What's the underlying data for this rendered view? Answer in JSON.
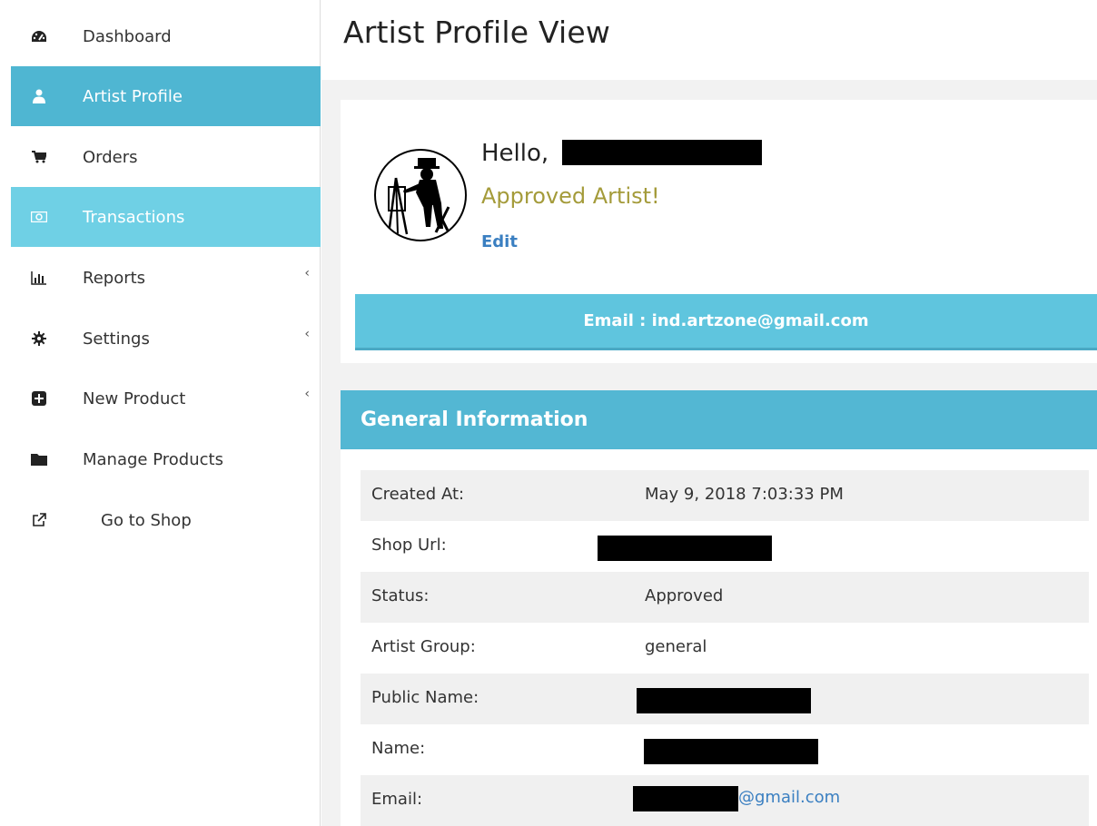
{
  "sidebar": {
    "items": [
      {
        "label": "Dashboard",
        "icon": "dashboard-icon"
      },
      {
        "label": "Artist Profile",
        "icon": "user-icon"
      },
      {
        "label": "Orders",
        "icon": "cart-icon"
      },
      {
        "label": "Transactions",
        "icon": "money-icon"
      },
      {
        "label": "Reports",
        "icon": "bar-chart-icon",
        "chevron": "‹"
      },
      {
        "label": "Settings",
        "icon": "gear-icon",
        "chevron": "‹"
      },
      {
        "label": "New Product",
        "icon": "plus-square-icon",
        "chevron": "‹"
      },
      {
        "label": "Manage Products",
        "icon": "folder-icon"
      },
      {
        "label": "Go to Shop",
        "icon": "external-link-icon"
      }
    ]
  },
  "header": {
    "title": "Artist Profile View"
  },
  "profile": {
    "greeting": "Hello,",
    "status_text": "Approved Artist!",
    "edit_label": "Edit",
    "email_bar": "Email : ind.artzone@gmail.com"
  },
  "general": {
    "title": "General Information",
    "rows": [
      {
        "label": "Created At:",
        "value": "May 9, 2018 7:03:33 PM"
      },
      {
        "label": "Shop Url:",
        "value": ""
      },
      {
        "label": "Status:",
        "value": "Approved"
      },
      {
        "label": "Artist Group:",
        "value": "general"
      },
      {
        "label": "Public Name:",
        "value": ""
      },
      {
        "label": "Name:",
        "value": ""
      },
      {
        "label": "Email:",
        "value": "@gmail.com"
      }
    ]
  },
  "colors": {
    "accent": "#4fb6d2",
    "accent_light": "#6fd0e5",
    "approved": "#a49b3a",
    "link": "#3a7fc1"
  }
}
